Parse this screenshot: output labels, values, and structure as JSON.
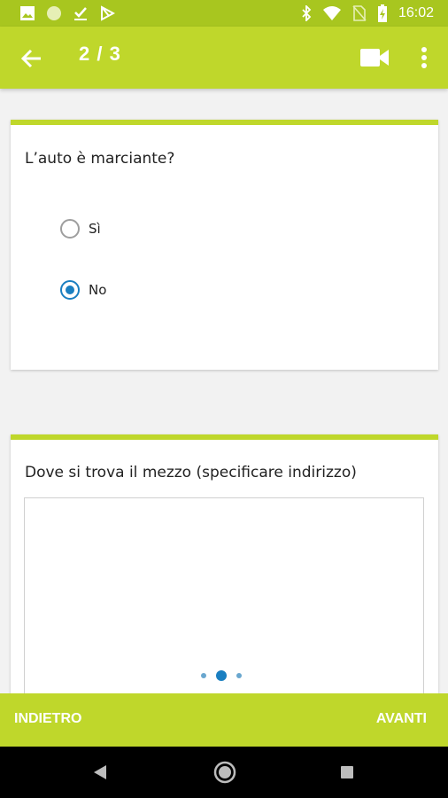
{
  "status_bar": {
    "time": "16:02",
    "left_icons": [
      "image-icon",
      "circle-icon",
      "download-done-icon",
      "play-store-icon"
    ],
    "right_icons": [
      "bluetooth-icon",
      "wifi-icon",
      "no-sim-icon",
      "battery-icon"
    ]
  },
  "toolbar": {
    "title": "2 / 3",
    "back_icon": "arrow-left-icon",
    "video_icon": "videocam-icon",
    "more_icon": "more-vert-icon"
  },
  "question1": {
    "title": "L’auto è marciante?",
    "options": [
      {
        "label": "Sì",
        "checked": false
      },
      {
        "label": "No",
        "checked": true
      }
    ]
  },
  "question2": {
    "title": "Dove si trova il mezzo (specificare indirizzo)",
    "value": ""
  },
  "pager": {
    "total": 3,
    "active": 2
  },
  "bottom_bar": {
    "back_label": "INDIETRO",
    "next_label": "AVANTI"
  },
  "colors": {
    "accent": "#bfd72b",
    "status_bar": "#a8c61f",
    "radio_selected": "#1a7fc1"
  }
}
